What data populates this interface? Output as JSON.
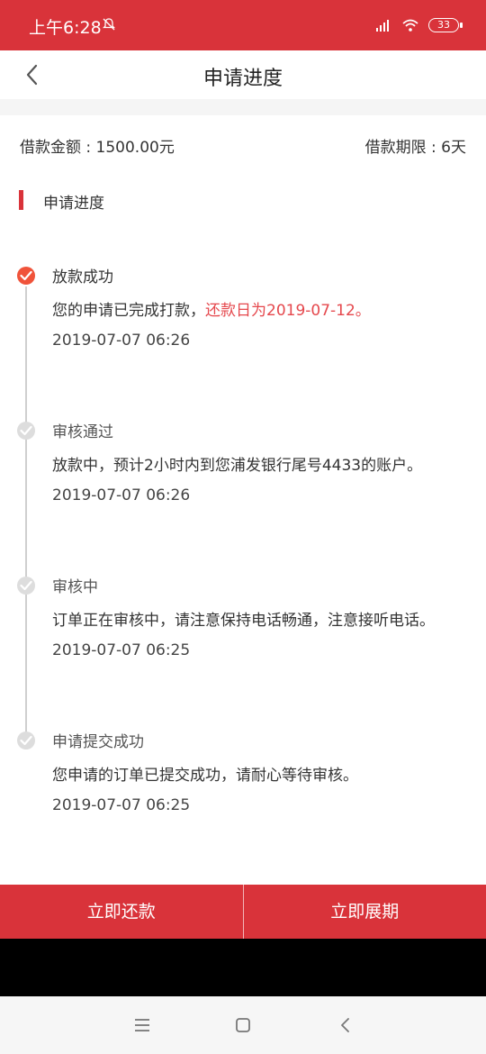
{
  "status_bar": {
    "time": "上午6:28",
    "battery": "33",
    "icons": [
      "mute-bell-icon",
      "signal-icon",
      "wifi-icon",
      "battery-icon"
    ]
  },
  "nav": {
    "title": "申请进度",
    "back_icon": "chevron-left-icon"
  },
  "summary": {
    "amount_label": "借款金额 : 1500.00元",
    "term_label": "借款期限 : 6天"
  },
  "section": {
    "title": "申请进度"
  },
  "steps": [
    {
      "title": "放款成功",
      "desc_prefix": "您的申请已完成打款，",
      "desc_highlight": "还款日为2019-07-12。",
      "time": "2019-07-07 06:26"
    },
    {
      "title": "审核通过",
      "desc_prefix": "放款中，预计2小时内到您浦发银行尾号4433的账户。",
      "desc_highlight": "",
      "time": "2019-07-07 06:26"
    },
    {
      "title": "审核中",
      "desc_prefix": "订单正在审核中，请注意保持电话畅通，注意接听电话。",
      "desc_highlight": "",
      "time": "2019-07-07 06:25"
    },
    {
      "title": "申请提交成功",
      "desc_prefix": "您申请的订单已提交成功，请耐心等待审核。",
      "desc_highlight": "",
      "time": "2019-07-07 06:25"
    }
  ],
  "actions": {
    "repay_label": "立即还款",
    "extend_label": "立即展期"
  },
  "colors": {
    "brand_red": "#d9333a",
    "active_dot": "#f0533a",
    "highlight_text": "#e5484d"
  }
}
